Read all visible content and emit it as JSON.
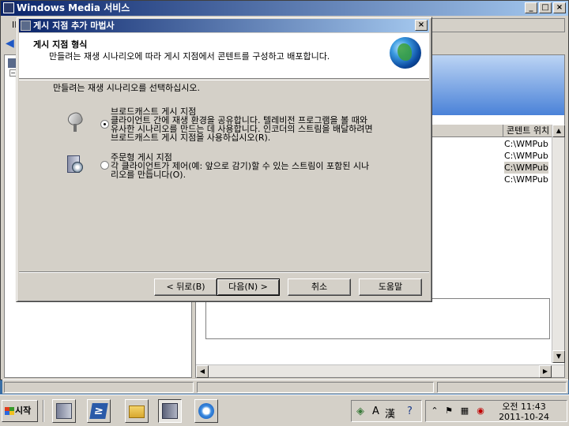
{
  "main_window": {
    "title": "Windows Media 서비스",
    "menu_fragment": "II",
    "min_glyph": "_",
    "max_glyph": "□",
    "close_glyph": "×",
    "list": {
      "column_header": "콘텐트 위치",
      "rows": [
        "C:\\WMPub",
        "C:\\WMPub",
        "C:\\WMPub",
        "C:\\WMPub"
      ]
    }
  },
  "wizard": {
    "title": "게시 지점 추가 마법사",
    "close_glyph": "×",
    "header_title": "게시 지점 형식",
    "header_desc": "만들려는 재생 시나리오에 따라 게시 지점에서 콘텐트를 구성하고 배포합니다.",
    "instruction": "만들려는 재생 시나리오를 선택하십시오.",
    "options": [
      {
        "title": "브로드캐스트 게시 지점",
        "lines": [
          "클라이언트 간에 재생 환경을 공유합니다. 텔레비전 프로그램을 볼 때와",
          "유사한 시나리오를 만드는 데 사용합니다. 인코더의 스트림을 배달하려면",
          "브로드캐스트 게시 지점을 사용하십시오(R)."
        ],
        "selected": true
      },
      {
        "title": "주문형 게시 지점",
        "lines": [
          "각 클라이언트가 제어(예: 앞으로 감기)할 수 있는 스트림이 포함된 시나",
          "리오를 만듭니다(O)."
        ],
        "selected": false
      }
    ],
    "buttons": {
      "back": "< 뒤로(B)",
      "next": "다음(N) >",
      "cancel": "취소",
      "help": "도움말"
    }
  },
  "taskbar": {
    "start_label": "시작",
    "lang_items": [
      "A",
      "漢"
    ],
    "clock_time": "오전 11:43",
    "clock_date": "2011-10-24"
  }
}
